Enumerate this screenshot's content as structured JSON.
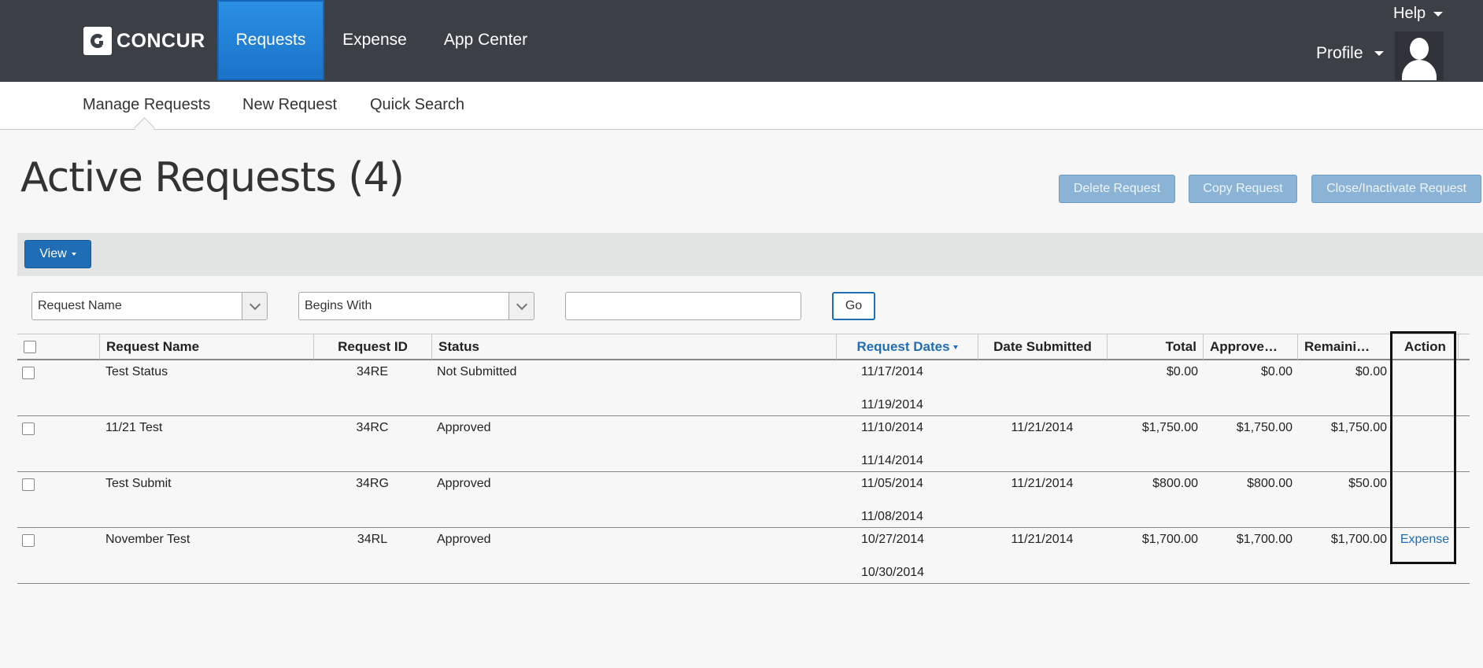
{
  "app": {
    "logo_text": "CONCUR"
  },
  "topnav": {
    "tabs": [
      {
        "label": "Requests",
        "active": true
      },
      {
        "label": "Expense",
        "active": false
      },
      {
        "label": "App Center",
        "active": false
      }
    ],
    "help_label": "Help",
    "profile_label": "Profile"
  },
  "subnav": {
    "items": [
      "Manage Requests",
      "New Request",
      "Quick Search"
    ],
    "selected": "Manage Requests"
  },
  "page": {
    "title": "Active Requests (4)",
    "buttons": {
      "delete": "Delete Request",
      "copy": "Copy Request",
      "close": "Close/Inactivate Request"
    },
    "view_label": "View"
  },
  "filter": {
    "field": "Request Name",
    "operator": "Begins With",
    "value": "",
    "go_label": "Go"
  },
  "table": {
    "columns": {
      "name": "Request Name",
      "id": "Request ID",
      "status": "Status",
      "dates": "Request Dates",
      "submitted": "Date Submitted",
      "total": "Total",
      "approved": "Approve…",
      "remaining": "Remaini…",
      "action": "Action"
    },
    "rows": [
      {
        "name": "Test Status",
        "id": "34RE",
        "status": "Not Submitted",
        "start": "11/17/2014",
        "end": "11/19/2014",
        "submitted": "",
        "total": "$0.00",
        "approved": "$0.00",
        "remaining": "$0.00",
        "action": ""
      },
      {
        "name": "11/21 Test",
        "id": "34RC",
        "status": "Approved",
        "start": "11/10/2014",
        "end": "11/14/2014",
        "submitted": "11/21/2014",
        "total": "$1,750.00",
        "approved": "$1,750.00",
        "remaining": "$1,750.00",
        "action": ""
      },
      {
        "name": "Test Submit",
        "id": "34RG",
        "status": "Approved",
        "start": "11/05/2014",
        "end": "11/08/2014",
        "submitted": "11/21/2014",
        "total": "$800.00",
        "approved": "$800.00",
        "remaining": "$50.00",
        "action": ""
      },
      {
        "name": "November Test",
        "id": "34RL",
        "status": "Approved",
        "start": "10/27/2014",
        "end": "10/30/2014",
        "submitted": "11/21/2014",
        "total": "$1,700.00",
        "approved": "$1,700.00",
        "remaining": "$1,700.00",
        "action": "Expense"
      }
    ]
  },
  "colors": {
    "topbar": "#3b3f46",
    "accent": "#1f6db5",
    "active_tab": "#1a73c9"
  }
}
